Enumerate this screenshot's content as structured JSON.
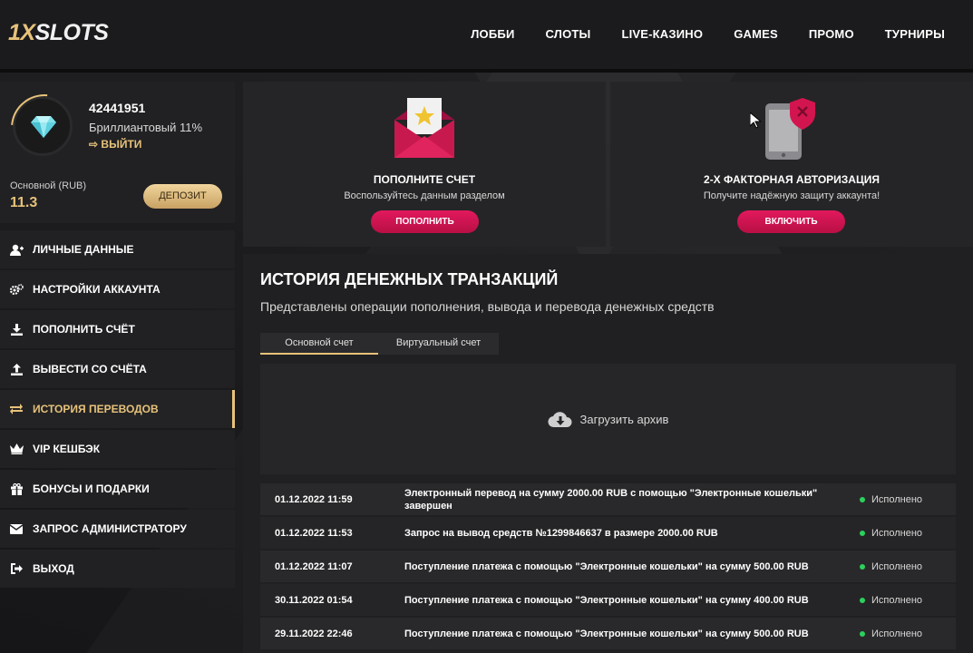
{
  "header": {
    "logo_accent": "1X",
    "logo_rest": "SLOTS",
    "nav": [
      "ЛОББИ",
      "СЛОТЫ",
      "LIVE-КАЗИНО",
      "GAMES",
      "ПРОМО",
      "ТУРНИРЫ"
    ]
  },
  "profile": {
    "user_id": "42441951",
    "level": "Бриллиантовый 11%",
    "logout": "ВЫЙТИ",
    "balance_label": "Основной (RUB)",
    "balance_value": "11.3",
    "deposit_btn": "ДЕПОЗИТ"
  },
  "menu": [
    {
      "label": "ЛИЧНЫЕ ДАННЫЕ",
      "icon": "user-icon",
      "active": false
    },
    {
      "label": "НАСТРОЙКИ АККАУНТА",
      "icon": "gears-icon",
      "active": false
    },
    {
      "label": "ПОПОЛНИТЬ СЧЁТ",
      "icon": "download-icon",
      "active": false
    },
    {
      "label": "ВЫВЕСТИ СО СЧЁТА",
      "icon": "upload-icon",
      "active": false
    },
    {
      "label": "ИСТОРИЯ ПЕРЕВОДОВ",
      "icon": "transfer-icon",
      "active": true
    },
    {
      "label": "VIP КЕШБЭК",
      "icon": "crown-icon",
      "active": false
    },
    {
      "label": "БОНУСЫ И ПОДАРКИ",
      "icon": "gift-icon",
      "active": false
    },
    {
      "label": "ЗАПРОС АДМИНИСТРАТОРУ",
      "icon": "envelope-icon",
      "active": false
    },
    {
      "label": "ВЫХОД",
      "icon": "exit-icon",
      "active": false
    }
  ],
  "cards": {
    "deposit": {
      "title": "ПОПОЛНИТЕ СЧЕТ",
      "subtitle": "Воспользуйтесь данным разделом",
      "button": "ПОПОЛНИТЬ"
    },
    "twofa": {
      "title": "2-Х ФАКТОРНАЯ АВТОРИЗАЦИЯ",
      "subtitle": "Получите надёжную защиту аккаунта!",
      "button": "ВКЛЮЧИТЬ"
    }
  },
  "main": {
    "title": "ИСТОРИЯ ДЕНЕЖНЫХ ТРАНЗАКЦИЙ",
    "description": "Представлены операции пополнения, вывода и перевода денежных средств",
    "tabs": [
      {
        "label": "Основной счет",
        "active": true
      },
      {
        "label": "Виртуальный счет",
        "active": false
      }
    ],
    "upload_label": "Загрузить архив"
  },
  "transactions": [
    {
      "date": "01.12.2022 11:59",
      "description": "Электронный перевод на сумму 2000.00 RUB с помощью \"Электронные кошельки\" завершен",
      "status": "Исполнено"
    },
    {
      "date": "01.12.2022 11:53",
      "description": "Запрос на вывод средств №1299846637 в размере 2000.00 RUB",
      "status": "Исполнено"
    },
    {
      "date": "01.12.2022 11:07",
      "description": "Поступление платежа с помощью \"Электронные кошельки\" на сумму 500.00 RUB",
      "status": "Исполнено"
    },
    {
      "date": "30.11.2022 01:54",
      "description": "Поступление платежа с помощью \"Электронные кошельки\" на сумму 400.00 RUB",
      "status": "Исполнено"
    },
    {
      "date": "29.11.2022 22:46",
      "description": "Поступление платежа с помощью \"Электронные кошельки\" на сумму 500.00 RUB",
      "status": "Исполнено"
    }
  ],
  "colors": {
    "accent": "#e7c27a",
    "button_red": "#d3154f",
    "status_green": "#2bd15c"
  }
}
